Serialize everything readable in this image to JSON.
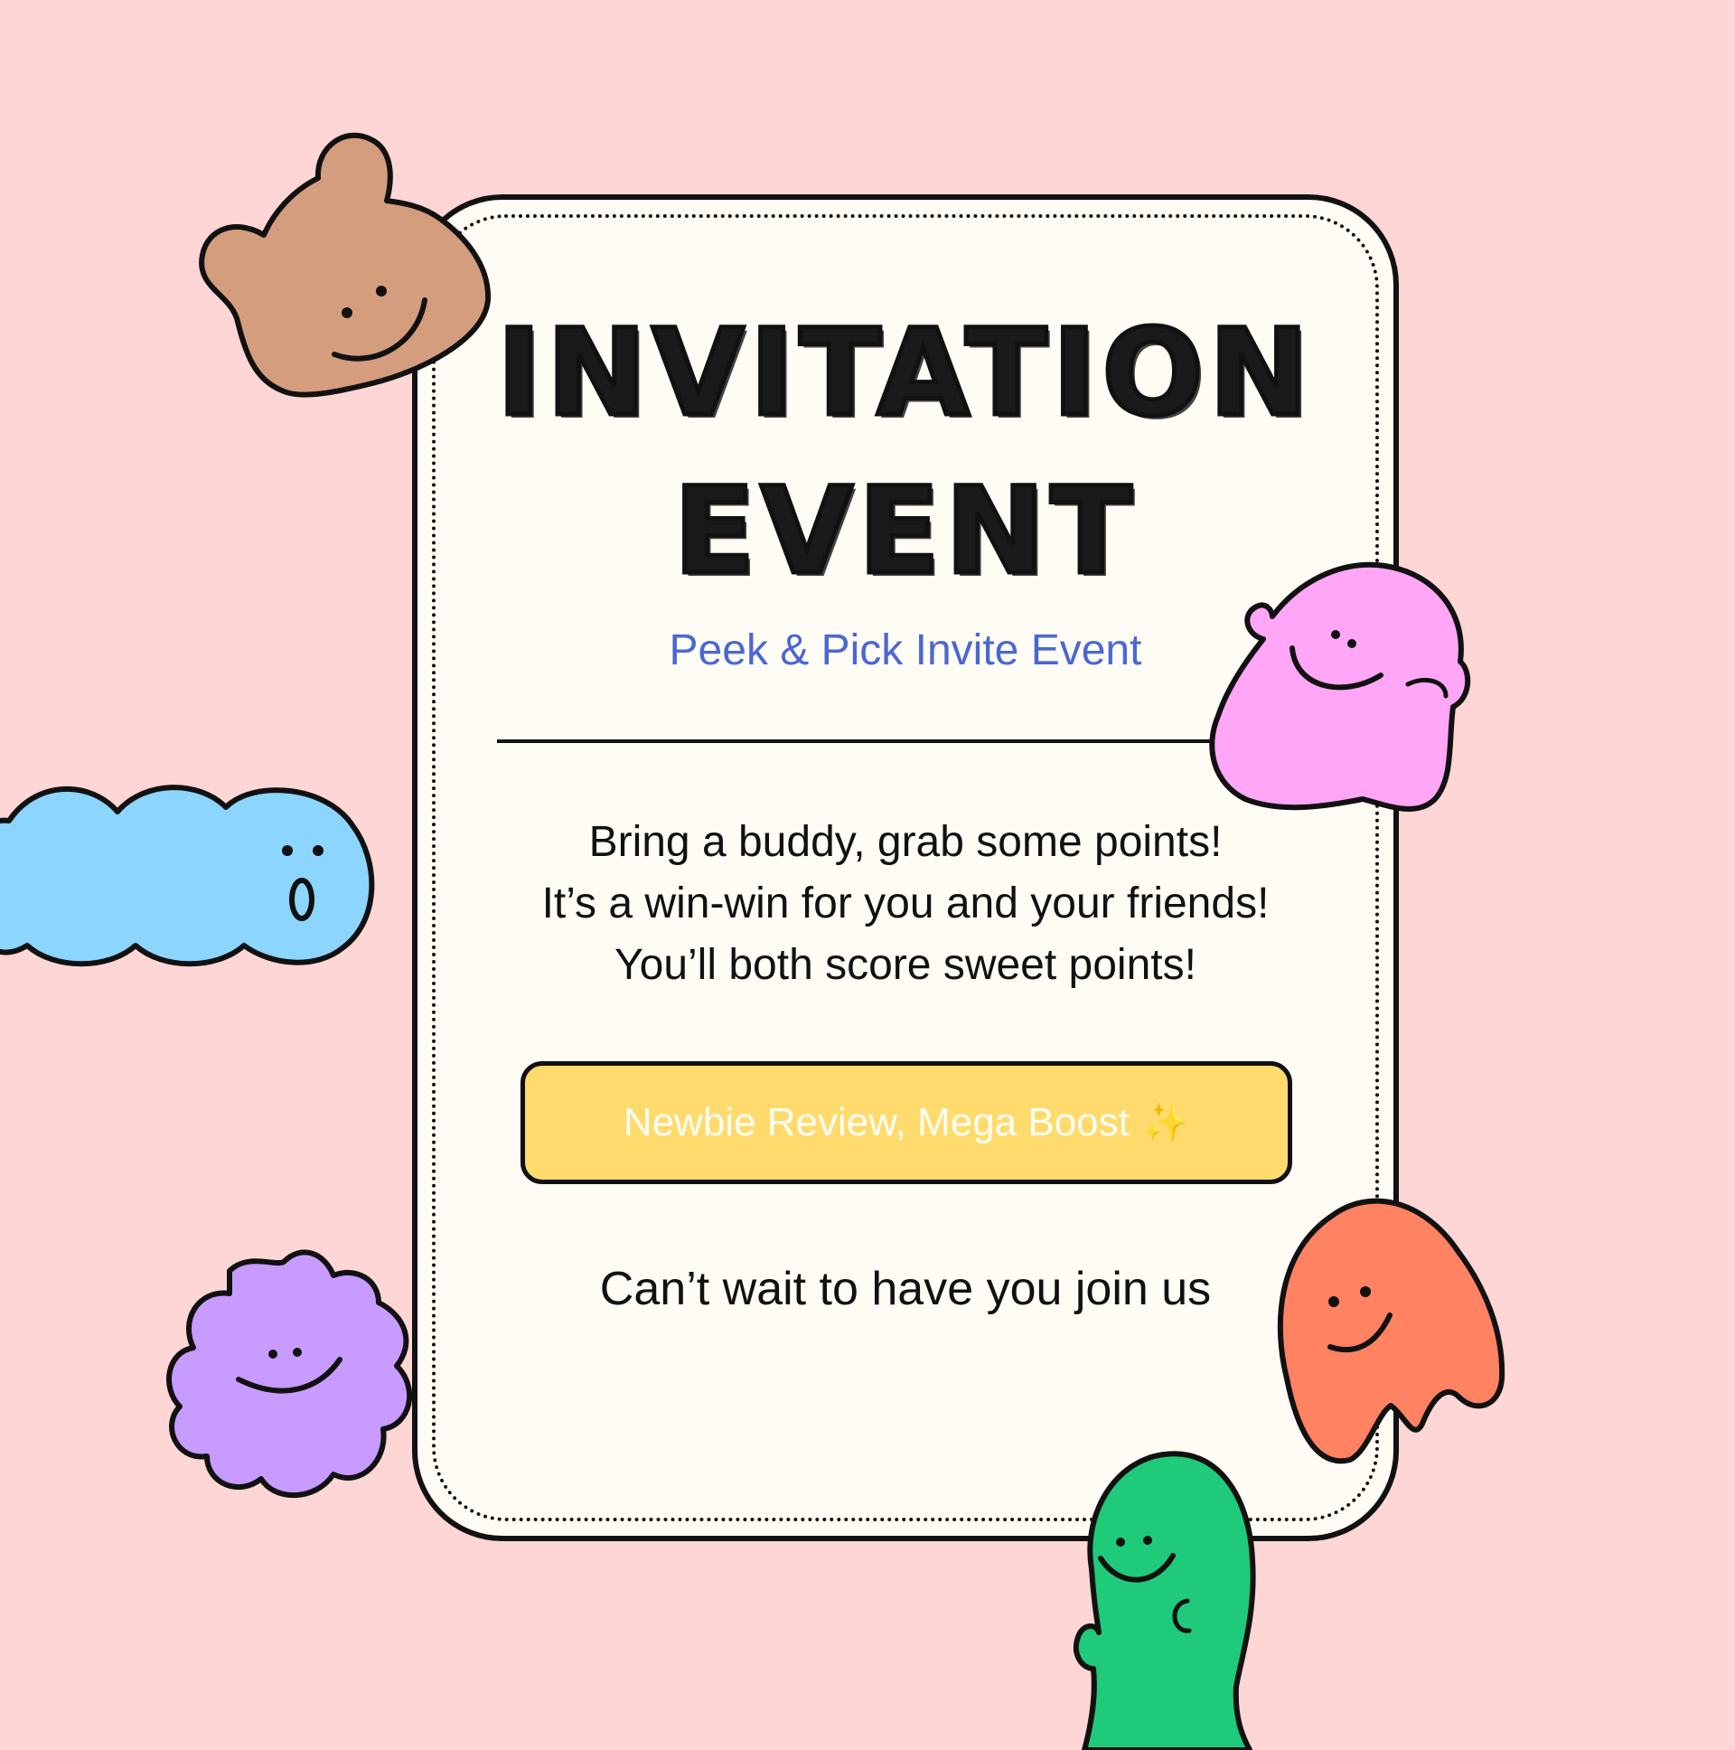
{
  "colors": {
    "background": "#FFD6D6",
    "card": "#FFFCF5",
    "subtitle": "#4B67D4",
    "button": "#FFDB6E",
    "button_text": "#FFFDF4",
    "bear": "#D49D7E",
    "pink_blob": "#FFA6F7",
    "blue_blob": "#8BD5FF",
    "purple_blob": "#C79BFF",
    "orange_ghost": "#FF8262",
    "green_bean": "#1FCB7A"
  },
  "title": {
    "line1": "INVITATION",
    "line2": "EVENT"
  },
  "subtitle": "Peek & Pick Invite Event",
  "body": {
    "line1": "Bring a buddy, grab some points!",
    "line2": "It’s a win-win for you and your friends!",
    "line3": "You’ll both score sweet points!"
  },
  "cta": {
    "label": "Newbie Review, Mega Boost",
    "icon": "sparkles-icon"
  },
  "closing": "Can’t wait to have you join us"
}
